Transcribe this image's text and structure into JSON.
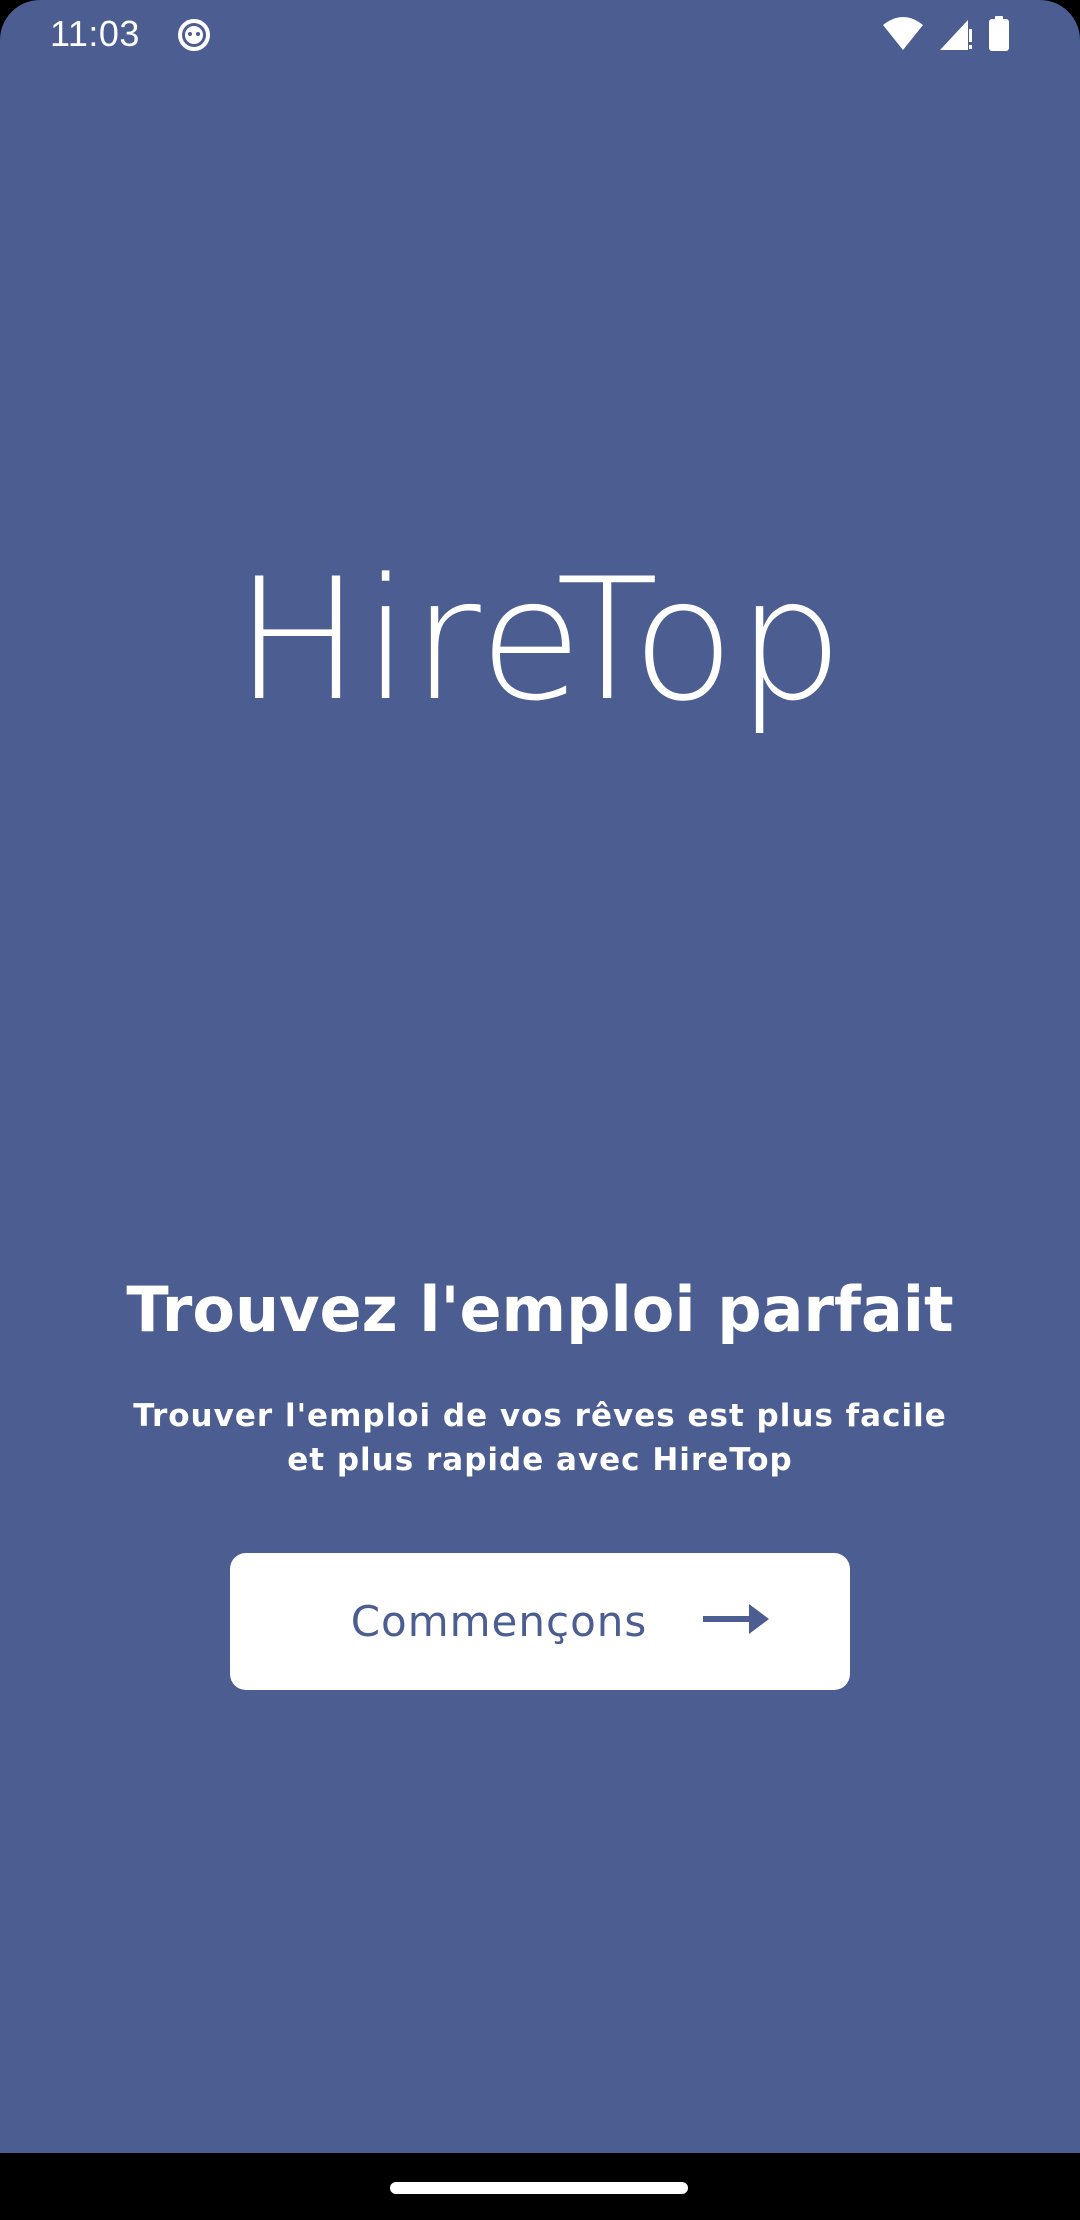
{
  "status_bar": {
    "time": "11:03",
    "icons": [
      "app-notification-icon",
      "wifi-icon",
      "cell-signal-icon",
      "battery-icon"
    ]
  },
  "app": {
    "logo_text": "HireTop"
  },
  "onboarding": {
    "headline": "Trouvez l'emploi parfait",
    "subtitle": "Trouver l'emploi de vos rêves est plus facile et plus rapide avec HireTop",
    "cta_label": "Commençons",
    "cta_icon": "arrow-right-icon"
  },
  "colors": {
    "background": "#4b5d91",
    "button_background": "#ffffff",
    "button_text": "#4b5d91",
    "text": "#ffffff",
    "navigation_bar": "#000000"
  }
}
